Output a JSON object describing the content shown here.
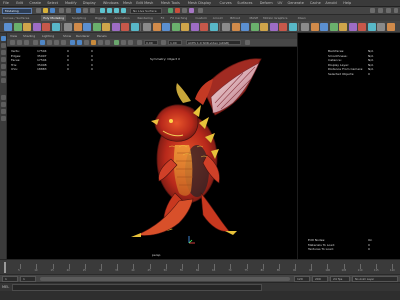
{
  "app": {
    "menus": [
      "File",
      "Edit",
      "Create",
      "Select",
      "Modify",
      "Display",
      "Windows",
      "Mesh",
      "Edit Mesh",
      "Mesh Tools",
      "Mesh Display",
      "Curves",
      "Surfaces",
      "Deform",
      "UV",
      "Generate",
      "Cache",
      "Arnold",
      "Help"
    ],
    "mode": "Modeling",
    "no_live_surface": "No Live Surface"
  },
  "shelf_tabs": [
    "Curves / Surfaces",
    "Poly Modeling",
    "Sculpting",
    "Rigging",
    "Animation",
    "Rendering",
    "FX",
    "FX Caching",
    "Custom",
    "Arnold",
    "Bifrost",
    "MASH",
    "Motion Graphics",
    "XGen"
  ],
  "panel_menu": [
    "View",
    "Shading",
    "Lighting",
    "Show",
    "Renderer",
    "Panels"
  ],
  "panel_bar": {
    "value_a": "0.00",
    "value_b": "1.00",
    "color_space": "ACES 1.0 SDR-video (sRGB)"
  },
  "hud": {
    "headers": [
      "",
      "",
      "",
      ""
    ],
    "rows": [
      {
        "label": "Verts:",
        "v1": "17504",
        "v2": "0",
        "v3": "0"
      },
      {
        "label": "Edges:",
        "v1": "35007",
        "v2": "0",
        "v3": "0"
      },
      {
        "label": "Faces:",
        "v1": "17504",
        "v2": "0",
        "v3": "0"
      },
      {
        "label": "Tris:",
        "v1": "35008",
        "v2": "0",
        "v3": "0"
      },
      {
        "label": "UVs:",
        "v1": "18883",
        "v2": "0",
        "v3": "0"
      }
    ],
    "symmetry": "Symmetry: Object X",
    "camera": "persp"
  },
  "right_info": {
    "rows": [
      {
        "k": "Backfaces:",
        "v": "N/A"
      },
      {
        "k": "Smoothness:",
        "v": "N/A"
      },
      {
        "k": "Instance:",
        "v": "N/A"
      },
      {
        "k": "Display Layer:",
        "v": "N/A"
      },
      {
        "k": "Distance From Camera:",
        "v": "N/A"
      },
      {
        "k": "Selected Objects:",
        "v": "0"
      }
    ],
    "bottom_rows": [
      {
        "k": "Edit Nodes:",
        "v": "On"
      },
      {
        "k": "Materials To Load:",
        "v": "0"
      },
      {
        "k": "Textures To Load:",
        "v": "0"
      }
    ]
  },
  "timeline": {
    "ticks": [
      "5",
      "10",
      "15",
      "20",
      "25",
      "30",
      "35",
      "40",
      "45",
      "50",
      "55",
      "60",
      "65",
      "70",
      "75",
      "80",
      "85",
      "90",
      "95",
      "100",
      "105",
      "110",
      "115",
      "120"
    ],
    "current_frame": "1"
  },
  "range": {
    "start": "1",
    "end": "120",
    "anim_start": "1",
    "anim_end": "200",
    "fps": "24 fps",
    "character_set": "No Character Set",
    "anim_layer": "No Anim Layer"
  },
  "cmd": {
    "label": "MEL",
    "help": ""
  }
}
